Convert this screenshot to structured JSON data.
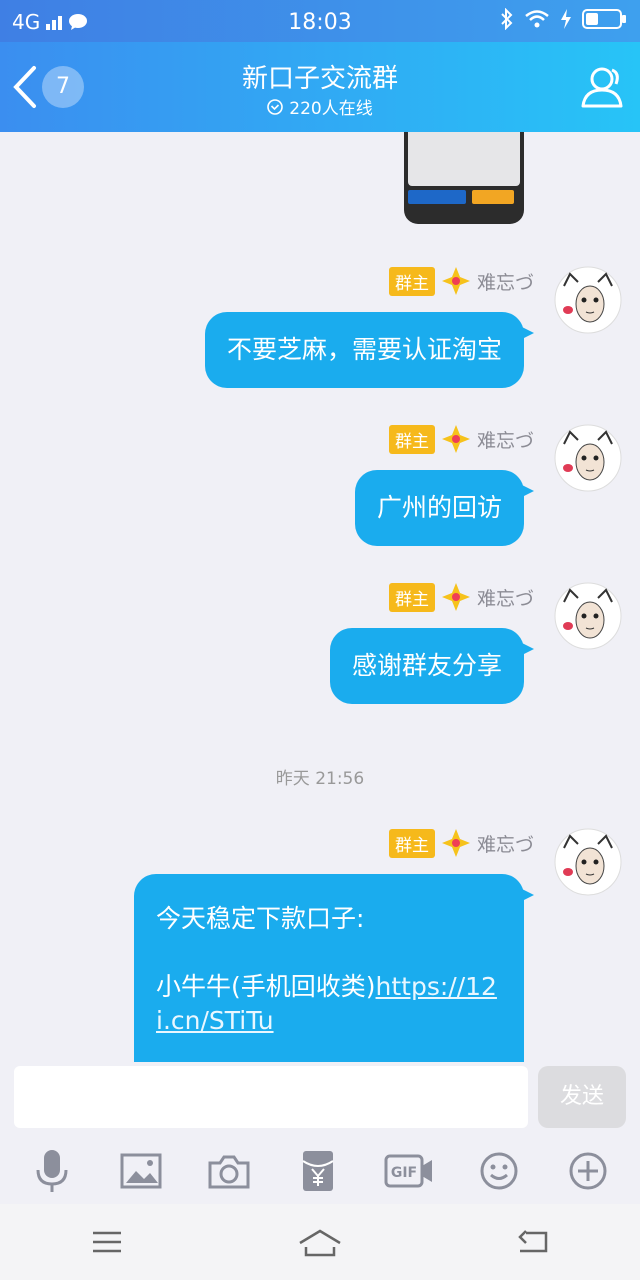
{
  "statusbar": {
    "network": "4G",
    "time": "18:03"
  },
  "header": {
    "back_count": "7",
    "title": "新口子交流群",
    "online": "220人在线"
  },
  "messages": [
    {
      "badge": "群主",
      "sender": "难忘づ",
      "text": "不要芝麻，需要认证淘宝"
    },
    {
      "badge": "群主",
      "sender": "难忘づ",
      "text": "广州的回访"
    },
    {
      "badge": "群主",
      "sender": "难忘づ",
      "text": "感谢群友分享"
    }
  ],
  "timestamp": "昨天 21:56",
  "last_message": {
    "badge": "群主",
    "sender": "难忘づ",
    "line1": "今天稳定下款口子:",
    "line2": "小牛牛(手机回收类)",
    "link": "https://12i.cn/STiTu"
  },
  "input": {
    "placeholder": "",
    "send_label": "发送"
  },
  "icons": {
    "toolbar": [
      "mic-icon",
      "image-icon",
      "camera-icon",
      "red-packet-icon",
      "gif-icon",
      "emoji-icon",
      "plus-icon"
    ],
    "nav": [
      "menu-icon",
      "home-icon",
      "back-icon"
    ]
  },
  "colors": {
    "bubble": "#1aacee",
    "header_start": "#3b8ef0",
    "header_end": "#27c4f7",
    "badge": "#f6b91b"
  }
}
